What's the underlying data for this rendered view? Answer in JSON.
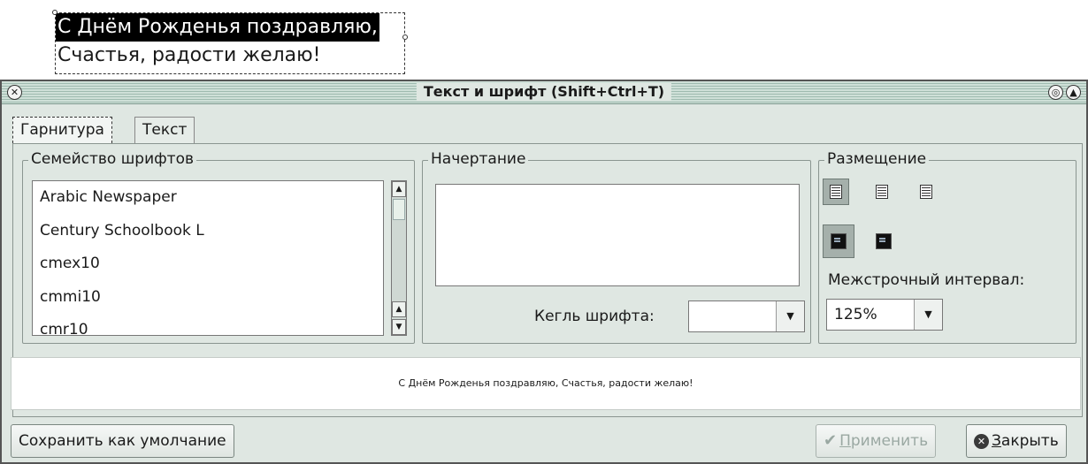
{
  "canvas": {
    "line1": "С Днём Рожденья поздравляю,",
    "line2": "Счастья, радости желаю!"
  },
  "dialog": {
    "title": "Текст и шрифт (Shift+Ctrl+T)",
    "titlebar_left_icon": "close-icon",
    "titlebar_right_icons": [
      "restore-icon",
      "shade-icon"
    ]
  },
  "tabs": [
    {
      "label": "Гарнитура",
      "active": true
    },
    {
      "label": "Текст",
      "active": false
    }
  ],
  "font_family": {
    "label": "Семейство шрифтов",
    "items": [
      "Arabic Newspaper",
      "Century Schoolbook L",
      "cmex10",
      "cmmi10",
      "cmr10"
    ]
  },
  "style": {
    "label": "Начертание",
    "size_label": "Кегль шрифта:",
    "size_value": ""
  },
  "layout": {
    "label": "Размещение",
    "align_left": "align-left-icon",
    "align_center": "align-center-icon",
    "align_right": "align-right-icon",
    "horizontal": "horizontal-text-icon",
    "vertical": "vertical-text-icon",
    "line_spacing_label": "Межстрочный интервал:",
    "line_spacing_value": "125%"
  },
  "preview": {
    "text": "С Днём Рожденья поздравляю,  Счастья, радости желаю!"
  },
  "buttons": {
    "save_default": "Сохранить как умолчание",
    "apply_first": "П",
    "apply_rest": "рименить",
    "close_first": "З",
    "close_rest": "акрыть"
  },
  "colors": {
    "dialog_bg": "#dfe7e2",
    "selection": "#000000"
  }
}
